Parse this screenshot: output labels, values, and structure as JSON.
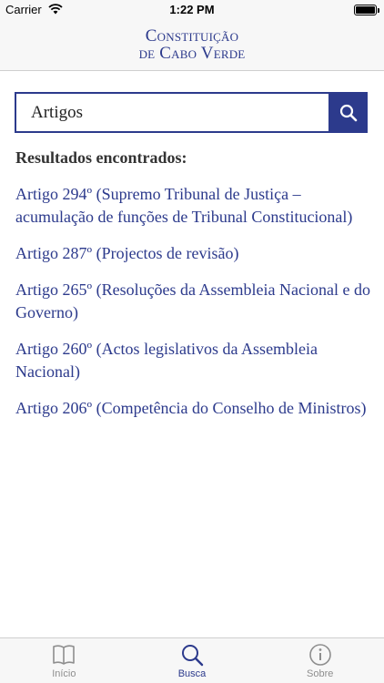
{
  "status_bar": {
    "carrier": "Carrier",
    "time": "1:22 PM"
  },
  "header": {
    "title_line1": "Constituição",
    "title_line2": "de Cabo Verde"
  },
  "search": {
    "value": "Artigos",
    "button_icon": "search-icon"
  },
  "results": {
    "heading": "Resultados encontrados:",
    "items": [
      "Artigo 294º (Supremo Tribunal de Justiça – acumulação de funções de Tribunal Constitucional)",
      "Artigo 287º (Projectos de revisão)",
      "Artigo 265º (Resoluções da Assembleia Nacional e do Governo)",
      "Artigo 260º (Actos legislativos da Assembleia Nacional)",
      "Artigo 206º (Competência do Conselho de Ministros)"
    ]
  },
  "tabs": [
    {
      "label": "Início",
      "icon": "book-icon",
      "active": false
    },
    {
      "label": "Busca",
      "icon": "search-icon",
      "active": true
    },
    {
      "label": "Sobre",
      "icon": "info-icon",
      "active": false
    }
  ],
  "colors": {
    "accent": "#2c3a8c",
    "bar_background": "#f7f7f7",
    "inactive_tab": "#8e8e8e"
  }
}
